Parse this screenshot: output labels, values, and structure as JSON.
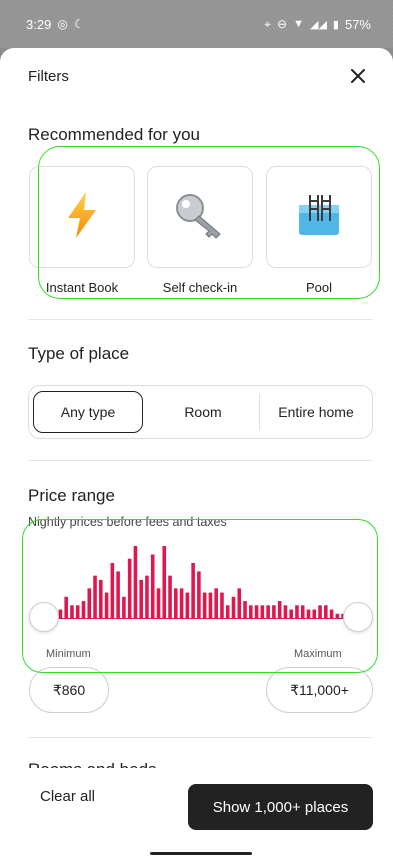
{
  "status_bar": {
    "time": "3:29",
    "battery": "57%"
  },
  "header": {
    "title": "Filters",
    "close_icon": "close-icon"
  },
  "recommended": {
    "title": "Recommended for you",
    "items": [
      {
        "label": "Instant Book",
        "icon": "lightning-icon"
      },
      {
        "label": "Self check-in",
        "icon": "key-icon"
      },
      {
        "label": "Pool",
        "icon": "pool-icon"
      }
    ]
  },
  "type_of_place": {
    "title": "Type of place",
    "options": [
      "Any type",
      "Room",
      "Entire home"
    ],
    "selected": "Any type"
  },
  "price_range": {
    "title": "Price range",
    "subtitle": "Nightly prices before fees and taxes",
    "min_label": "Minimum",
    "max_label": "Maximum",
    "min_value": "₹860",
    "max_value": "₹11,000+",
    "bar_color": "#e0174f",
    "histogram": [
      2,
      1,
      2,
      5,
      3,
      3,
      4,
      7,
      10,
      9,
      6,
      13,
      11,
      5,
      14,
      17,
      9,
      10,
      15,
      7,
      17,
      10,
      7,
      7,
      6,
      13,
      11,
      6,
      6,
      7,
      6,
      3,
      5,
      7,
      4,
      3,
      3,
      3,
      3,
      3,
      4,
      3,
      2,
      3,
      3,
      2,
      2,
      3,
      3,
      2,
      1,
      1
    ]
  },
  "next_section_peek": "Rooms and beds",
  "footer": {
    "clear_label": "Clear all",
    "show_label": "Show 1,000+ places"
  },
  "colors": {
    "highlight": "#2ede1f",
    "primary_button": "#222222"
  }
}
